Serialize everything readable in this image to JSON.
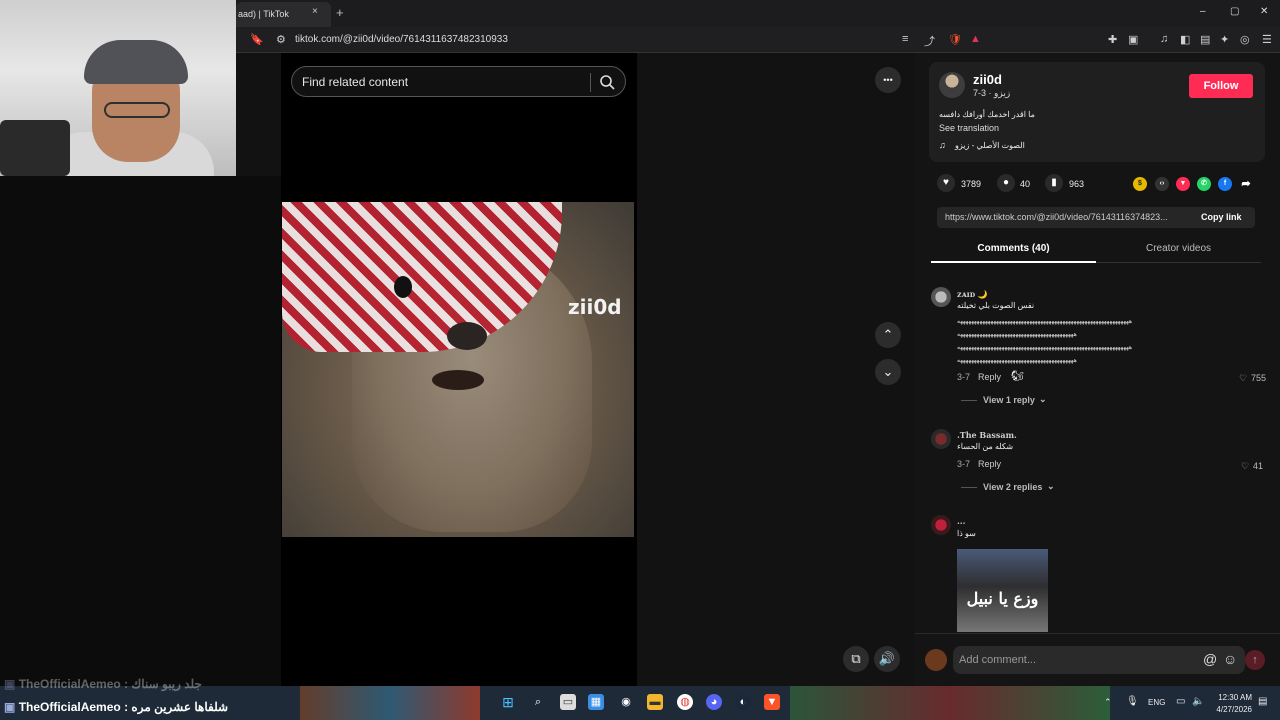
{
  "browser": {
    "tab_title": "aad) | TikTok",
    "tab_close": "×",
    "new_tab": "+",
    "url": "tiktok.com/@zii0d/video/7614311637482310933",
    "window_controls": [
      "–",
      "▢",
      "✕"
    ]
  },
  "video": {
    "search_placeholder": "Find related content",
    "watermark": "zii0d",
    "more_icon": "•••",
    "up_icon": "⌃",
    "down_icon": "⌄"
  },
  "post": {
    "author": "zii0d",
    "author_sub": "زيزو · 3-7",
    "follow_label": "Follow",
    "description": "ما اقدر اخدمك أورافك دافسه",
    "see_translation": "See translation",
    "sound": "الصوت الأصلي - زيزو",
    "likes": "3789",
    "comments_count": "40",
    "saves": "963",
    "link": "https://www.tiktok.com/@zii0d/video/76143116374823...",
    "copy_link": "Copy link"
  },
  "tabs": {
    "comments": "Comments (40)",
    "creator": "Creator videos"
  },
  "comments": [
    {
      "name": "ᴢᴀɪᴅ 🌙",
      "text": "نفس الصوت بلي تخيلته",
      "extra": [
        "ههههههههههههههههههههههههههههههههههههههههههههههههههههههههههههههه",
        "ههههههههههههههههههههههههههههههههههههههههههه",
        "ههههههههههههههههههههههههههههههههههههههههههههههههههههههههههههههه",
        "ههههههههههههههههههههههههههههههههههههههههههه"
      ],
      "date": "3-7",
      "reply": "Reply",
      "likes": "755",
      "view_replies": "View 1 reply"
    },
    {
      "name": ".The Bassam.",
      "text": "شكله من الحساء",
      "date": "3-7",
      "reply": "Reply",
      "likes": "41",
      "view_replies": "View 2 replies"
    },
    {
      "name": "...",
      "text": "سو ذا",
      "image_text": "وزع يا نبيل"
    }
  ],
  "add_comment_placeholder": "Add comment...",
  "chat": {
    "line1_user": "TheOfficialAemeo",
    "line1_text": ": جلد ريبو سناك",
    "line2_user": "TheOfficialAemeo",
    "line2_text": ": شلفاها عشرين مره"
  },
  "taskbar": {
    "lang": "ENG",
    "time": "12:30 AM",
    "date": "4/27/2026"
  },
  "colors": {
    "follow": "#fe2c55",
    "chat_user": "#ffffff",
    "accent_like": "#fe2c55"
  }
}
